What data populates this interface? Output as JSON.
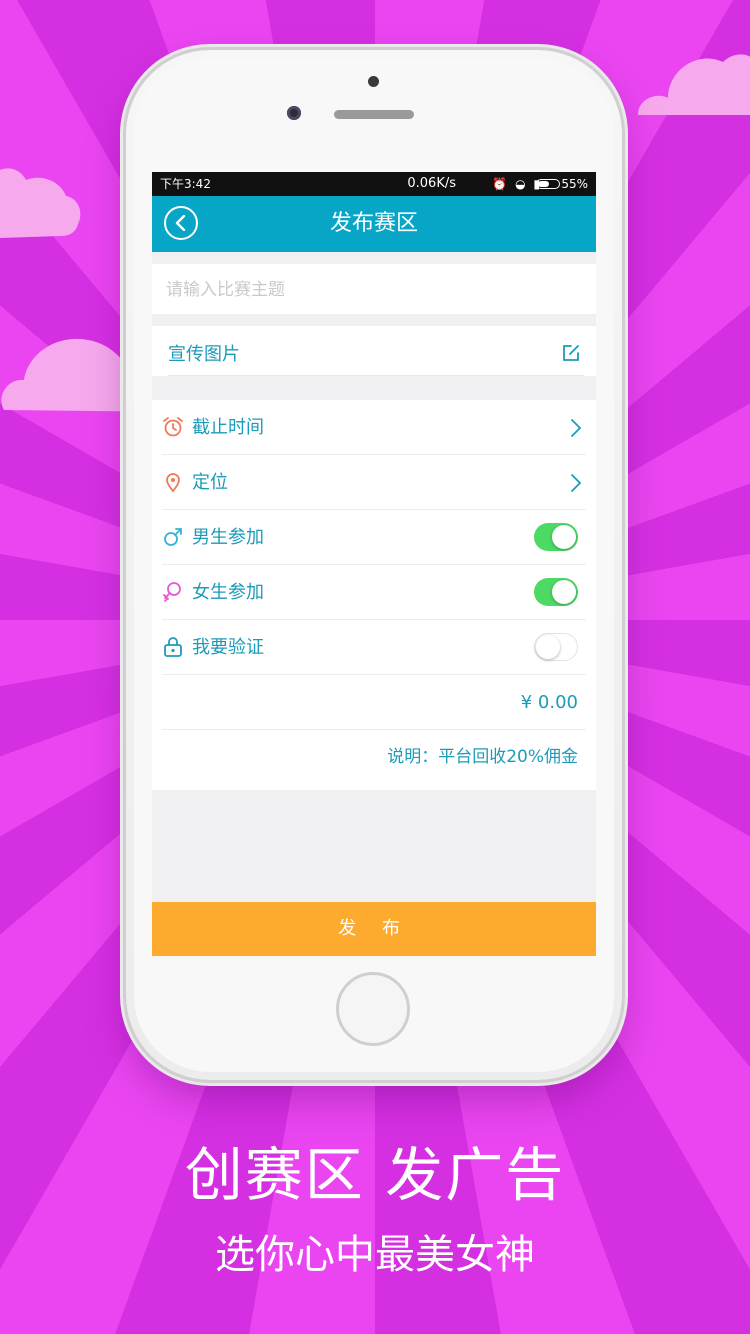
{
  "status_bar": {
    "time": "下午3:42",
    "net_speed": "0.06K/s",
    "battery": "55%"
  },
  "header": {
    "title": "发布赛区"
  },
  "subject": {
    "placeholder": "请输入比赛主题"
  },
  "promo": {
    "label": "宣传图片"
  },
  "settings": {
    "deadline": "截止时间",
    "location": "定位",
    "male": "男生参加",
    "male_on": true,
    "female": "女生参加",
    "female_on": true,
    "verify": "我要验证",
    "verify_on": false,
    "price": "¥  0.00",
    "note": "说明：平台回收20%佣金"
  },
  "publish_button": "发  布",
  "slogan": {
    "line1": "创赛区  发广告",
    "line2": "选你心中最美女神"
  },
  "colors": {
    "background": "#e23be8",
    "header": "#07a6c7",
    "accent_text": "#1b9bb9",
    "toggle_on": "#4cd964",
    "publish": "#fdab2f"
  }
}
